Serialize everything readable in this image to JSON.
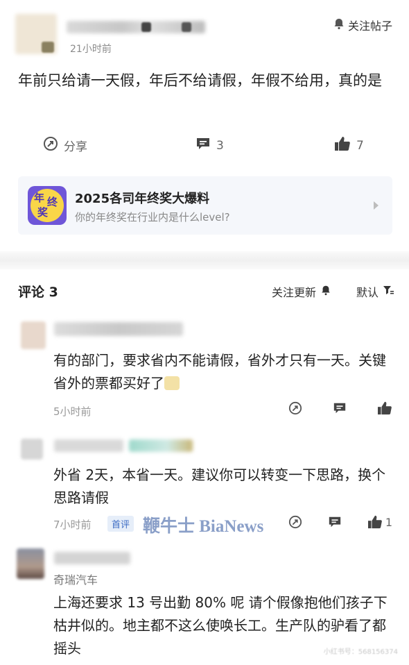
{
  "post": {
    "time": "21小时前",
    "follow_label": "关注帖子",
    "text": "年前只给请一天假，年后不给请假，年假不给用，真的是",
    "actions": {
      "share_label": "分享",
      "comment_count": "3",
      "like_count": "7"
    }
  },
  "topic_card": {
    "logo_text": [
      "年",
      "终",
      "奖"
    ],
    "title": "2025各司年终奖大爆料",
    "subtitle": "你的年终奖在行业内是什么level?"
  },
  "comments_header": {
    "title": "评论 3",
    "follow_updates": "关注更新",
    "sort": "默认"
  },
  "comments": [
    {
      "text": "有的部门，要求省内不能请假，省外才只有一天。关键省外的票都买好了",
      "time": "5小时前",
      "like_count": ""
    },
    {
      "text": "外省 2天，本省一天。建议你可以转变一下思路，换个思路请假",
      "time": "7小时前",
      "badge": "首评",
      "like_count": "1"
    },
    {
      "company": "奇瑞汽车",
      "text": "上海还要求 13 号出勤 80% 呢 请个假像抱他们孩子下枯井似的。地主都不这么使唤长工。生产队的驴看了都摇头"
    }
  ],
  "watermark": "鞭牛士 BiaNews",
  "corner_watermark": "小红书号：568156374",
  "colors": {
    "accent": "#3d6cc4",
    "icon_gray": "#4a4a4a",
    "muted": "#999999",
    "card_bg": "#f5f7fb"
  }
}
